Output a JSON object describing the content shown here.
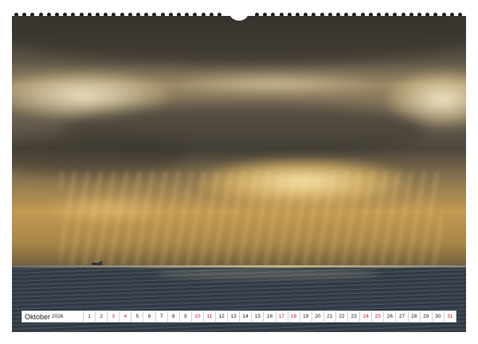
{
  "calendar": {
    "month": "Oktober",
    "year": "2026",
    "days": [
      {
        "n": "1",
        "weekend": false
      },
      {
        "n": "2",
        "weekend": false
      },
      {
        "n": "3",
        "weekend": true
      },
      {
        "n": "4",
        "weekend": true
      },
      {
        "n": "5",
        "weekend": false
      },
      {
        "n": "6",
        "weekend": false
      },
      {
        "n": "7",
        "weekend": false
      },
      {
        "n": "8",
        "weekend": false
      },
      {
        "n": "9",
        "weekend": false
      },
      {
        "n": "10",
        "weekend": true
      },
      {
        "n": "11",
        "weekend": true
      },
      {
        "n": "12",
        "weekend": false
      },
      {
        "n": "13",
        "weekend": false
      },
      {
        "n": "14",
        "weekend": false
      },
      {
        "n": "15",
        "weekend": false
      },
      {
        "n": "16",
        "weekend": false
      },
      {
        "n": "17",
        "weekend": true
      },
      {
        "n": "18",
        "weekend": true
      },
      {
        "n": "19",
        "weekend": false
      },
      {
        "n": "20",
        "weekend": false
      },
      {
        "n": "21",
        "weekend": false
      },
      {
        "n": "22",
        "weekend": false
      },
      {
        "n": "23",
        "weekend": false
      },
      {
        "n": "24",
        "weekend": true
      },
      {
        "n": "25",
        "weekend": true
      },
      {
        "n": "26",
        "weekend": false
      },
      {
        "n": "27",
        "weekend": false
      },
      {
        "n": "28",
        "weekend": false
      },
      {
        "n": "29",
        "weekend": false
      },
      {
        "n": "30",
        "weekend": false
      },
      {
        "n": "31",
        "weekend": true
      }
    ]
  },
  "colors": {
    "weekend": "#c0212b",
    "weekday": "#1c1c1c",
    "sky": "#9c8a67",
    "sea": "#36404b"
  }
}
